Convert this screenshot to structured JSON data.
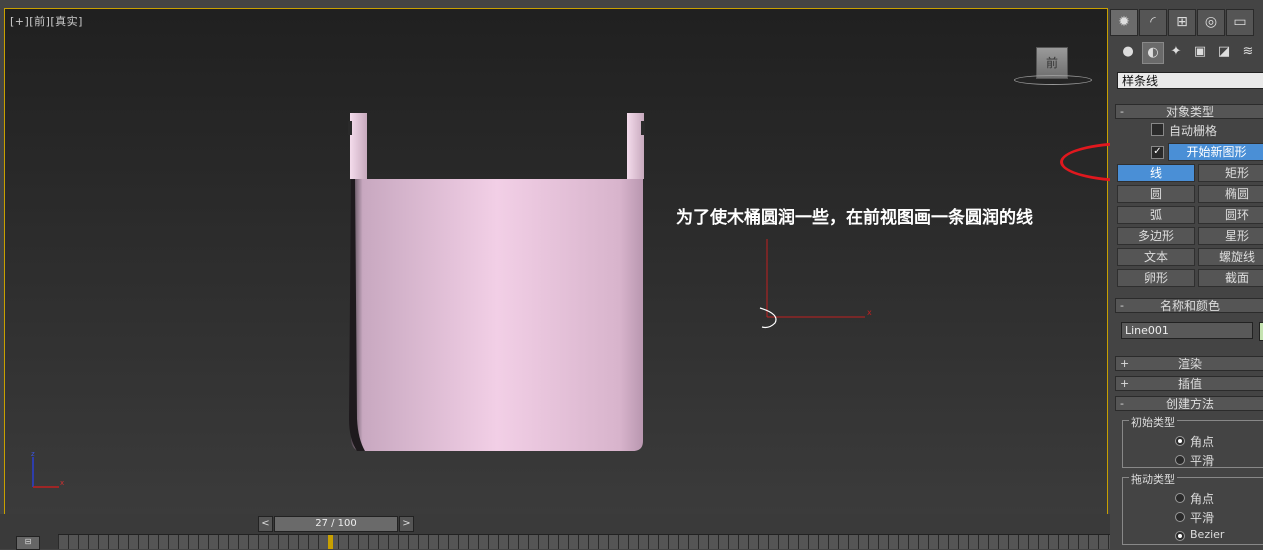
{
  "viewport": {
    "label": "[+][前][真实]",
    "annotation": "为了使木桶圆润一些，在前视图画一条圆润的线",
    "viewcube_label": "前"
  },
  "timeline": {
    "frame_display": "27 / 100",
    "prev": "<",
    "next": ">",
    "current_frame": 27,
    "total_frames": 100
  },
  "command_panel": {
    "tabs": [
      {
        "icon": "create-icon",
        "glyph": "✹"
      },
      {
        "icon": "modify-icon",
        "glyph": "◜"
      },
      {
        "icon": "hierarchy-icon",
        "glyph": "⊞"
      },
      {
        "icon": "motion-icon",
        "glyph": "◎"
      },
      {
        "icon": "display-icon",
        "glyph": "▭"
      }
    ],
    "subcategories": [
      {
        "icon": "geometry-icon",
        "glyph": "●"
      },
      {
        "icon": "shapes-icon",
        "glyph": "◐"
      },
      {
        "icon": "lights-icon",
        "glyph": "✦"
      },
      {
        "icon": "cameras-icon",
        "glyph": "▣"
      },
      {
        "icon": "helpers-icon",
        "glyph": "◪"
      },
      {
        "icon": "spacewarps-icon",
        "glyph": "≋"
      }
    ],
    "category_dropdown": "样条线",
    "object_type": {
      "title": "对象类型",
      "autogrid": "自动栅格",
      "start_new_shape": "开始新图形",
      "buttons": [
        "线",
        "矩形",
        "圆",
        "椭圆",
        "弧",
        "圆环",
        "多边形",
        "星形",
        "文本",
        "螺旋线",
        "卵形",
        "截面"
      ]
    },
    "name_color": {
      "title": "名称和颜色",
      "name": "Line001",
      "color": "#c4e2b0"
    },
    "rollouts": {
      "render": "渲染",
      "interpolation": "插值",
      "creation_method": "创建方法"
    },
    "initial_type": {
      "title": "初始类型",
      "options": [
        "角点",
        "平滑"
      ],
      "selected": "角点"
    },
    "drag_type": {
      "title": "拖动类型",
      "options": [
        "角点",
        "平滑",
        "Bezier"
      ],
      "selected": "Bezier"
    }
  }
}
